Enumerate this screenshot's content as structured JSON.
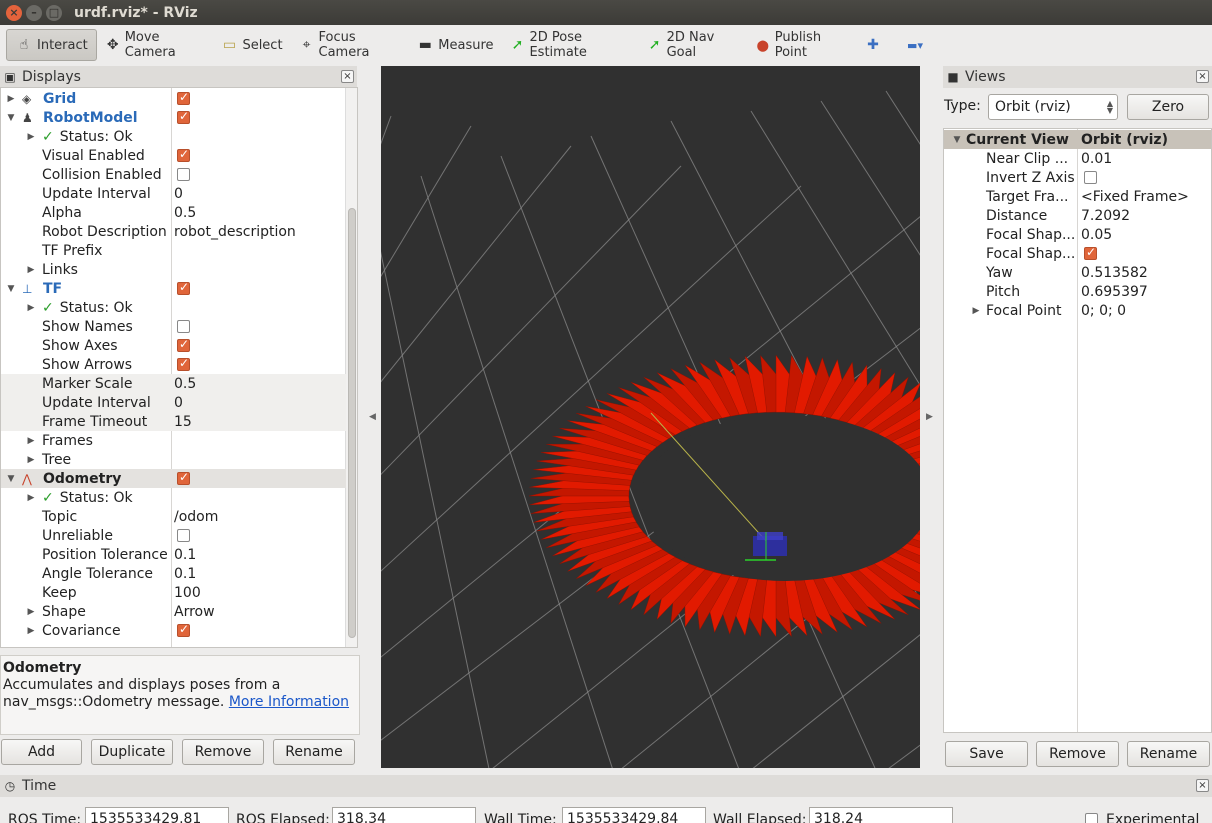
{
  "window": {
    "title": "urdf.rviz* - RViz"
  },
  "toolbar": {
    "tools": [
      {
        "label": "Interact",
        "icon": "hand-icon",
        "glyph": "☝",
        "active": true
      },
      {
        "label": "Move Camera",
        "icon": "move-camera-icon",
        "glyph": "✥"
      },
      {
        "label": "Select",
        "icon": "select-icon",
        "glyph": "▭"
      },
      {
        "label": "Focus Camera",
        "icon": "focus-camera-icon",
        "glyph": "⌖"
      },
      {
        "label": "Measure",
        "icon": "ruler-icon",
        "glyph": "▬"
      },
      {
        "label": "2D Pose Estimate",
        "icon": "pose-estimate-icon",
        "glyph": "➚"
      },
      {
        "label": "2D Nav Goal",
        "icon": "nav-goal-icon",
        "glyph": "➚"
      },
      {
        "label": "Publish Point",
        "icon": "map-pin-icon",
        "glyph": "⬤"
      }
    ]
  },
  "displays": {
    "title": "Displays",
    "rows": [
      {
        "type": "cat",
        "label": "Grid",
        "depth": 0,
        "expander": "▶",
        "checked": true
      },
      {
        "type": "cat",
        "label": "RobotModel",
        "depth": 0,
        "expander": "▼",
        "checked": true
      },
      {
        "type": "status",
        "label": "Status: Ok",
        "depth": 1,
        "expander": "▶"
      },
      {
        "type": "prop",
        "label": "Visual Enabled",
        "depth": 1,
        "checked": true
      },
      {
        "type": "prop",
        "label": "Collision Enabled",
        "depth": 1,
        "checked": false
      },
      {
        "type": "prop",
        "label": "Update Interval",
        "depth": 1,
        "value": "0"
      },
      {
        "type": "prop",
        "label": "Alpha",
        "depth": 1,
        "value": "0.5"
      },
      {
        "type": "prop",
        "label": "Robot Description",
        "depth": 1,
        "value": "robot_description"
      },
      {
        "type": "prop",
        "label": "TF Prefix",
        "depth": 1,
        "value": ""
      },
      {
        "type": "prop",
        "label": "Links",
        "depth": 1,
        "expander": "▶"
      },
      {
        "type": "cat",
        "label": "TF",
        "depth": 0,
        "expander": "▼",
        "checked": true
      },
      {
        "type": "status",
        "label": "Status: Ok",
        "depth": 1,
        "expander": "▶"
      },
      {
        "type": "prop",
        "label": "Show Names",
        "depth": 1,
        "checked": false
      },
      {
        "type": "prop",
        "label": "Show Axes",
        "depth": 1,
        "checked": true
      },
      {
        "type": "prop",
        "label": "Show Arrows",
        "depth": 1,
        "checked": true
      },
      {
        "type": "prop",
        "label": "Marker Scale",
        "depth": 1,
        "value": "0.5"
      },
      {
        "type": "prop",
        "label": "Update Interval",
        "depth": 1,
        "value": "0"
      },
      {
        "type": "prop",
        "label": "Frame Timeout",
        "depth": 1,
        "value": "15"
      },
      {
        "type": "prop",
        "label": "Frames",
        "depth": 1,
        "expander": "▶"
      },
      {
        "type": "prop",
        "label": "Tree",
        "depth": 1,
        "expander": "▶"
      },
      {
        "type": "catsel",
        "label": "Odometry",
        "depth": 0,
        "expander": "▼",
        "checked": true
      },
      {
        "type": "status",
        "label": "Status: Ok",
        "depth": 1,
        "expander": "▶"
      },
      {
        "type": "prop",
        "label": "Topic",
        "depth": 1,
        "value": "/odom"
      },
      {
        "type": "prop",
        "label": "Unreliable",
        "depth": 1,
        "checked": false
      },
      {
        "type": "prop",
        "label": "Position Tolerance",
        "depth": 1,
        "value": "0.1"
      },
      {
        "type": "prop",
        "label": "Angle Tolerance",
        "depth": 1,
        "value": "0.1"
      },
      {
        "type": "prop",
        "label": "Keep",
        "depth": 1,
        "value": "100"
      },
      {
        "type": "prop",
        "label": "Shape",
        "depth": 1,
        "expander": "▶",
        "value": "Arrow"
      },
      {
        "type": "prop",
        "label": "Covariance",
        "depth": 1,
        "expander": "▶",
        "checked": true
      }
    ],
    "description": {
      "title": "Odometry",
      "text": "Accumulates and displays poses from a nav_msgs::Odometry message.",
      "link": "More Information"
    },
    "buttons": {
      "add": "Add",
      "duplicate": "Duplicate",
      "remove": "Remove",
      "rename": "Rename"
    }
  },
  "views": {
    "title": "Views",
    "type_label": "Type:",
    "type_value": "Orbit (rviz)",
    "zero_label": "Zero",
    "header": {
      "name": "Current View",
      "value": "Orbit (rviz)"
    },
    "rows": [
      {
        "label": "Near Clip ...",
        "value": "0.01"
      },
      {
        "label": "Invert Z Axis",
        "checked": false
      },
      {
        "label": "Target Fra...",
        "value": "<Fixed Frame>"
      },
      {
        "label": "Distance",
        "value": "7.2092"
      },
      {
        "label": "Focal Shap...",
        "value": "0.05"
      },
      {
        "label": "Focal Shap...",
        "checked": true
      },
      {
        "label": "Yaw",
        "value": "0.513582"
      },
      {
        "label": "Pitch",
        "value": "0.695397"
      },
      {
        "label": "Focal Point",
        "value": "0; 0; 0",
        "expander": "▶"
      }
    ],
    "buttons": {
      "save": "Save",
      "remove": "Remove",
      "rename": "Rename"
    }
  },
  "time": {
    "title": "Time",
    "ros_time_label": "ROS Time:",
    "ros_time": "1535533429.81",
    "ros_elapsed_label": "ROS Elapsed:",
    "ros_elapsed": "318.34",
    "wall_time_label": "Wall Time:",
    "wall_time": "1535533429.84",
    "wall_elapsed_label": "Wall Elapsed:",
    "wall_elapsed": "318.24",
    "experimental_label": "Experimental"
  },
  "colors": {
    "arrow": "#e21a00",
    "grid": "#8a8a8a",
    "viewport_bg": "#303030",
    "check": "#e0653a",
    "link": "#1b57c9"
  }
}
